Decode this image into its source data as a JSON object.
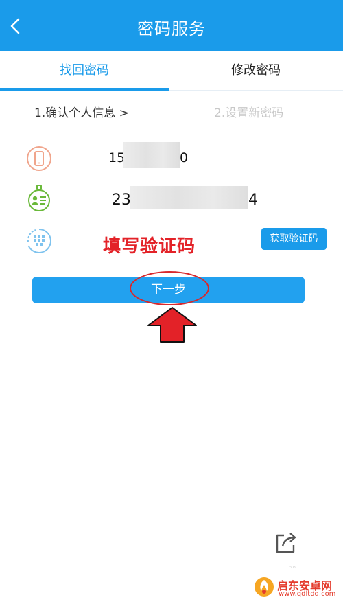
{
  "header": {
    "title": "密码服务",
    "back_icon": "chevron-left-icon"
  },
  "tabs": [
    {
      "label": "找回密码",
      "active": true
    },
    {
      "label": "修改密码",
      "active": false
    }
  ],
  "steps": {
    "step1": "1.确认个人信息 >",
    "step2": "2.设置新密码"
  },
  "form": {
    "phone": {
      "prefix": "15",
      "suffix": "0",
      "icon": "phone-icon"
    },
    "id_card": {
      "prefix": "23",
      "suffix": "4",
      "icon": "id-card-icon"
    },
    "captcha": {
      "icon": "captcha-icon",
      "get_code_label": "获取验证码"
    }
  },
  "annotation": {
    "text": "填写验证码"
  },
  "next_button": {
    "label": "下一步"
  },
  "share_icon": "share-icon",
  "watermark": {
    "name": "启东安卓网",
    "url": "www.qdltdq.com"
  },
  "colors": {
    "primary": "#1a9bea",
    "annotation_red": "#e32228",
    "disabled_text": "#c8c8c8"
  }
}
